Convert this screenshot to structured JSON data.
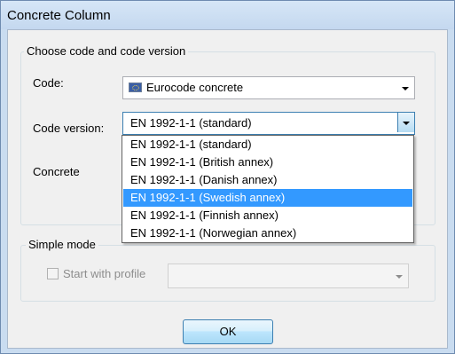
{
  "window": {
    "title": "Concrete Column"
  },
  "code_group": {
    "label": "Choose code and code version",
    "code_label": "Code:",
    "code_value": "Eurocode concrete",
    "code_icon": "eu-flag-icon",
    "version_label": "Code version:",
    "version_value": "EN 1992-1-1 (standard)",
    "concrete_label": "Concrete"
  },
  "version_dropdown": {
    "items": [
      "EN 1992-1-1 (standard)",
      "EN 1992-1-1 (British annex)",
      "EN 1992-1-1 (Danish annex)",
      "EN 1992-1-1 (Swedish annex)",
      "EN 1992-1-1 (Finnish annex)",
      "EN 1992-1-1 (Norwegian annex)"
    ],
    "highlighted": "EN 1992-1-1 (Swedish annex)"
  },
  "simple_mode": {
    "label": "Simple mode",
    "checkbox_label": "Start with profile",
    "checked": false,
    "profile_value": ""
  },
  "buttons": {
    "ok": "OK"
  },
  "colors": {
    "highlight": "#3399ff",
    "dialog_bg": "#f0f0f0",
    "frame": "#c9dcf0"
  }
}
